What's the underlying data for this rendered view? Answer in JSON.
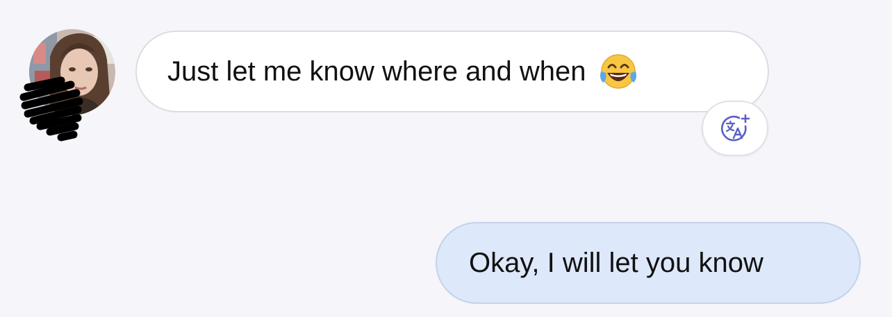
{
  "conversation": {
    "messages": [
      {
        "direction": "incoming",
        "text": "Just let me know where and when",
        "emoji_icon": "face-with-tears-of-joy-icon"
      },
      {
        "direction": "outgoing",
        "text": "Okay, I will let you know"
      }
    ],
    "translate_icon": "translate-icon"
  },
  "colors": {
    "background": "#f5f5fa",
    "incoming_bubble": "#ffffff",
    "outgoing_bubble": "#dde8fa",
    "accent": "#5a5fc8"
  }
}
